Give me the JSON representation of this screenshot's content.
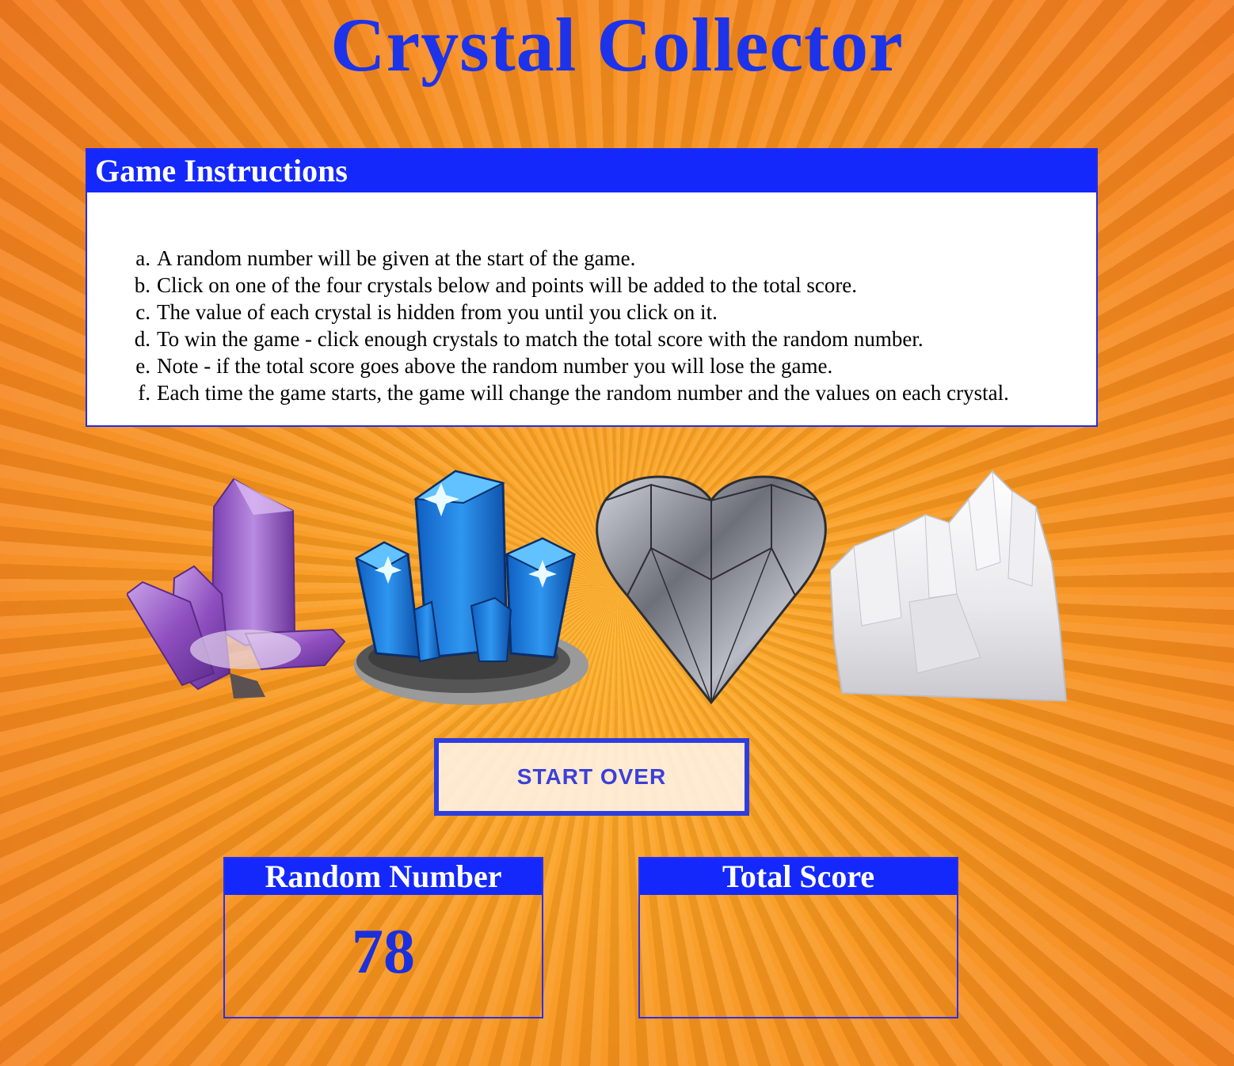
{
  "title": "Crystal Collector",
  "instructions": {
    "heading": "Game Instructions",
    "items": [
      {
        "marker": "a.",
        "text": "A random number will be given at the start of the game."
      },
      {
        "marker": "b.",
        "text": "Click on one of the four crystals below and points will be added to the total score."
      },
      {
        "marker": "c.",
        "text": "The value of each crystal is hidden from you until you click on it."
      },
      {
        "marker": "d.",
        "text": "To win the game - click enough crystals to match the total score with the random number."
      },
      {
        "marker": "e.",
        "text": "Note - if the total score goes above the random number you will lose the game."
      },
      {
        "marker": "f.",
        "text": "Each time the game starts, the game will change the random number and the values on each crystal."
      }
    ]
  },
  "crystals": [
    {
      "icon": "purple-amethyst-crystal-icon",
      "color": "#9b5fc8"
    },
    {
      "icon": "blue-crystal-cluster-icon",
      "color": "#1e7fe0"
    },
    {
      "icon": "silver-heart-crystal-icon",
      "color": "#8a8d96"
    },
    {
      "icon": "white-quartz-crystal-icon",
      "color": "#eeeeee"
    }
  ],
  "start_button": {
    "label": "START OVER"
  },
  "random_number": {
    "label": "Random Number",
    "value": "78"
  },
  "total_score": {
    "label": "Total Score",
    "value": ""
  },
  "colors": {
    "accent_blue": "#1428fb",
    "title_blue": "#1c33ea",
    "background_orange": "#f7941d"
  }
}
